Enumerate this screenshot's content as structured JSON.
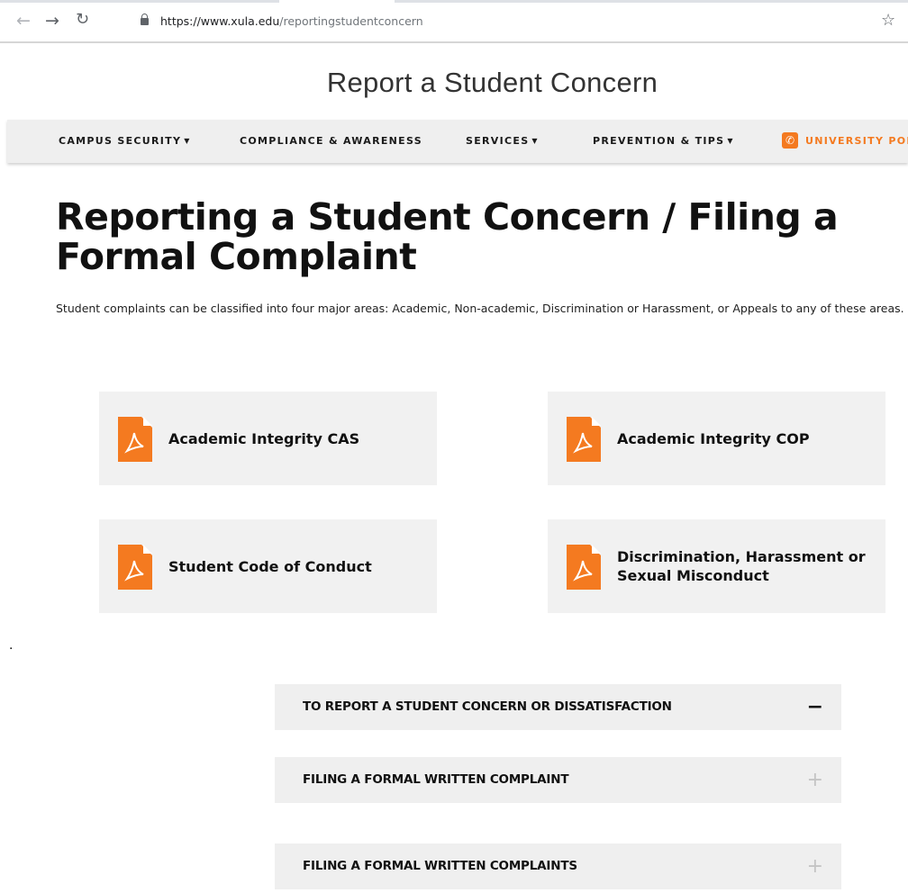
{
  "browser": {
    "url_domain": "https://www.xula.edu",
    "url_path": "/reportingstudentconcern"
  },
  "site": {
    "title": "Report a Student Concern"
  },
  "nav": {
    "items": [
      {
        "label": "CAMPUS SECURITY",
        "has_caret": true
      },
      {
        "label": "COMPLIANCE & AWARENESS",
        "has_caret": false
      },
      {
        "label": "SERVICES",
        "has_caret": true
      },
      {
        "label": "PREVENTION & TIPS",
        "has_caret": true
      }
    ],
    "phone_label": "UNIVERSITY POL"
  },
  "page": {
    "heading": "Reporting a Student Concern / Filing a Formal Complaint",
    "intro": "Student complaints can be classified into four major areas: Academic, Non-academic, Discrimination or Harassment, or Appeals to any of these areas.",
    "dot": "."
  },
  "documents": [
    {
      "label": "Academic Integrity CAS",
      "icon": "pdf-icon"
    },
    {
      "label": "Academic Integrity COP",
      "icon": "pdf-icon"
    },
    {
      "label": "Student Code of Conduct",
      "icon": "pdf-icon"
    },
    {
      "label": "Discrimination, Harassment or Sexual Misconduct",
      "icon": "pdf-icon"
    }
  ],
  "accordion": [
    {
      "title": "TO REPORT A STUDENT CONCERN OR DISSATISFACTION",
      "toggle": "−",
      "expanded": true
    },
    {
      "title": "FILING A FORMAL WRITTEN COMPLAINT",
      "toggle": "+",
      "expanded": false
    },
    {
      "title": "FILING A FORMAL WRITTEN COMPLAINTS",
      "toggle": "+",
      "expanded": false
    }
  ],
  "colors": {
    "accent": "#f47a20",
    "card_bg": "#f1f1f1",
    "nav_bg": "#efefef"
  }
}
